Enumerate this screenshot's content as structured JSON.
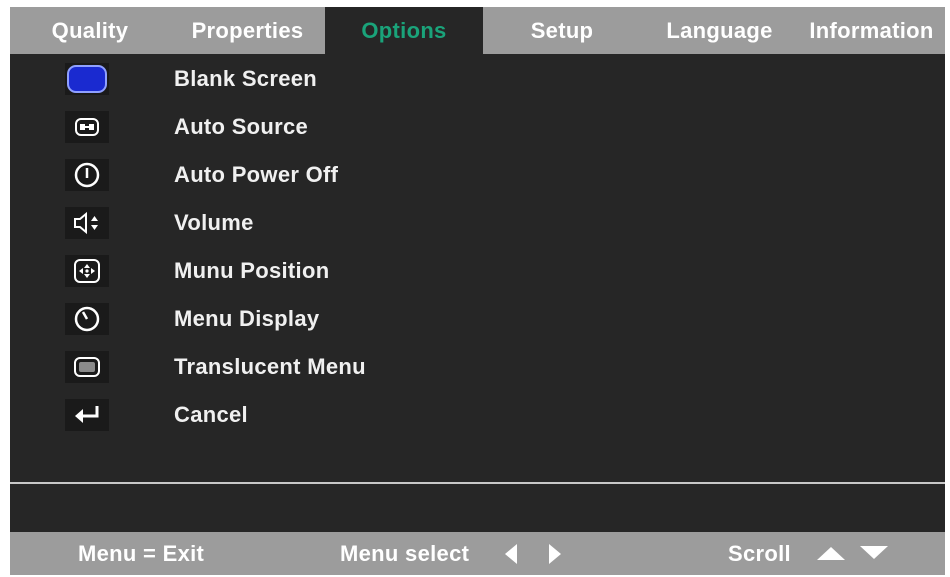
{
  "tabs": [
    {
      "label": "Quality",
      "active": false
    },
    {
      "label": "Properties",
      "active": false
    },
    {
      "label": "Options",
      "active": true
    },
    {
      "label": "Setup",
      "active": false
    },
    {
      "label": "Language",
      "active": false
    },
    {
      "label": "Information",
      "active": false
    }
  ],
  "menu": {
    "items": [
      {
        "label": "Blank Screen",
        "icon": "blank-screen-icon"
      },
      {
        "label": "Auto Source",
        "icon": "auto-source-icon"
      },
      {
        "label": "Auto Power Off",
        "icon": "power-icon"
      },
      {
        "label": "Volume",
        "icon": "volume-icon"
      },
      {
        "label": "Munu Position",
        "icon": "menu-position-icon"
      },
      {
        "label": "Menu Display",
        "icon": "clock-icon"
      },
      {
        "label": "Translucent Menu",
        "icon": "translucent-icon"
      },
      {
        "label": "Cancel",
        "icon": "return-icon"
      }
    ]
  },
  "footer": {
    "exit_label": "Menu = Exit",
    "select_label": "Menu select",
    "scroll_label": "Scroll"
  },
  "colors": {
    "background": "#262626",
    "bar": "#9c9c9c",
    "active_tab_text": "#1aa37a",
    "text": "#ffffff"
  }
}
